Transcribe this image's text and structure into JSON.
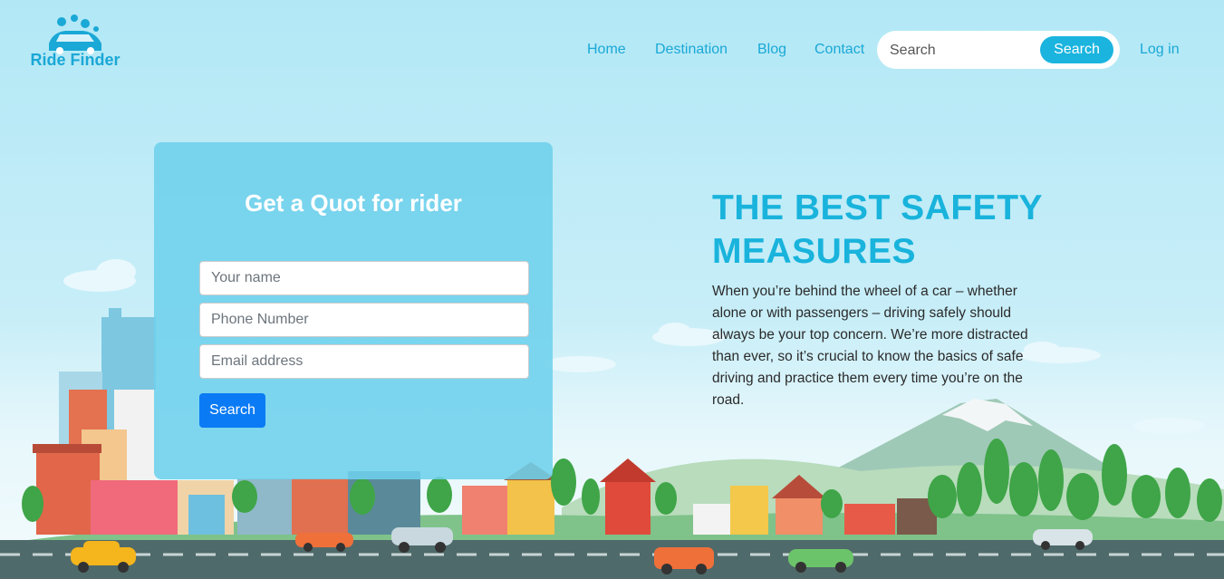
{
  "brand": {
    "name": "Ride Finder",
    "logo_icon": "car-wash-icon"
  },
  "nav": {
    "items": [
      "Home",
      "Destination",
      "Blog",
      "Contact"
    ],
    "login_label": "Log in"
  },
  "search": {
    "placeholder": "Search",
    "button_label": "Search"
  },
  "quote_form": {
    "title": "Get a Quot for rider",
    "name_placeholder": "Your name",
    "phone_placeholder": "Phone Number",
    "email_placeholder": "Email address",
    "button_label": "Search"
  },
  "hero": {
    "title": "THE BEST SAFETY MEASURES",
    "body": "When you’re behind the wheel of a car – whether alone or with passengers – driving safely should always be your top concern. We’re more distracted than ever, so it’s crucial to know the basics of safe driving and practice them every time you’re on the road."
  },
  "colors": {
    "accent": "#1ab4de",
    "primary_button": "#0a7bf5",
    "road": "#4f6a6a"
  }
}
